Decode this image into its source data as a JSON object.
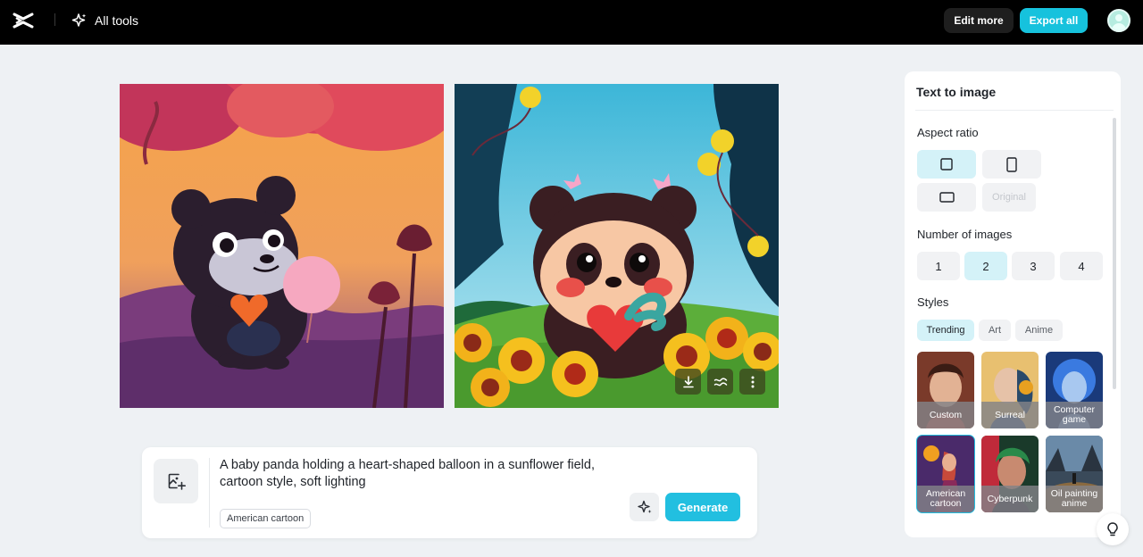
{
  "header": {
    "all_tools_label": "All tools",
    "edit_more_label": "Edit more",
    "export_all_label": "Export all"
  },
  "prompt": {
    "text": "A baby panda holding a heart-shaped balloon in a sunflower field, cartoon style, soft lighting",
    "style_chip": "American cartoon",
    "generate_label": "Generate"
  },
  "panel": {
    "title": "Text to image",
    "aspect_ratio_title": "Aspect ratio",
    "aspect_original_label": "Original",
    "number_title": "Number of images",
    "numbers": [
      "1",
      "2",
      "3",
      "4"
    ],
    "number_selected": "2",
    "styles_title": "Styles",
    "style_tabs": [
      "Trending",
      "Art",
      "Anime"
    ],
    "style_tab_selected": "Trending",
    "styles": [
      {
        "label": "Custom"
      },
      {
        "label": "Surreal"
      },
      {
        "label": "Computer game"
      },
      {
        "label": "American cartoon"
      },
      {
        "label": "Cyberpunk"
      },
      {
        "label": "Oil painting anime"
      }
    ],
    "style_selected": "American cartoon"
  },
  "colors": {
    "accent": "#16c2dd",
    "selected_bg": "#d4f2f8",
    "topbar": "#000000"
  },
  "icons": [
    "capcut-logo-icon",
    "sparkle-icon",
    "download-icon",
    "wave-icon",
    "more-icon",
    "add-reference-image-icon",
    "magic-wand-icon",
    "lightbulb-icon",
    "square-ratio-icon",
    "portrait-ratio-icon",
    "landscape-ratio-icon"
  ]
}
